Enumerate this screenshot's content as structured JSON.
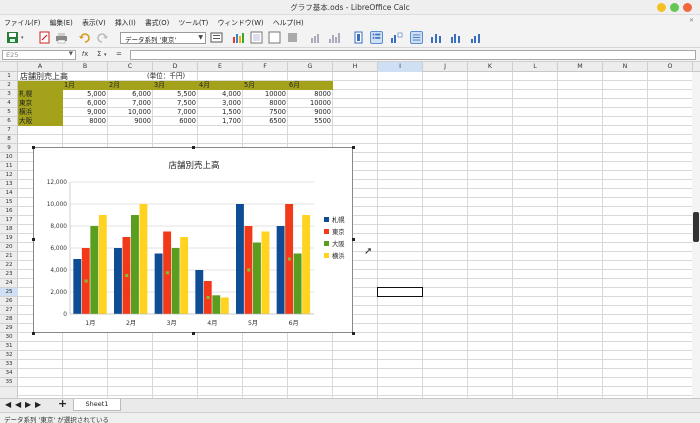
{
  "window": {
    "title": "グラフ基本.ods - LibreOffice Calc"
  },
  "menu": [
    "ファイル(F)",
    "編集(E)",
    "表示(V)",
    "挿入(I)",
    "書式(O)",
    "ツール(T)",
    "ウィンドウ(W)",
    "ヘルプ(H)"
  ],
  "toolbar": {
    "combo_value": "データ系列 '東京'"
  },
  "formula_bar": {
    "name_box": "E25",
    "sum_symbol": "Σ",
    "equals_symbol": "="
  },
  "columns": [
    "A",
    "B",
    "C",
    "D",
    "E",
    "F",
    "G",
    "H",
    "I",
    "J",
    "K",
    "L",
    "M",
    "N",
    "O"
  ],
  "rows": [
    "1",
    "2",
    "3",
    "4",
    "5",
    "6",
    "7",
    "8",
    "9",
    "10",
    "11",
    "12",
    "13",
    "14",
    "15",
    "16",
    "17",
    "18",
    "19",
    "20",
    "21",
    "22",
    "23",
    "24",
    "25",
    "26",
    "27",
    "28",
    "29",
    "30",
    "31",
    "32",
    "33",
    "34",
    "35"
  ],
  "table": {
    "title": "店舗別売上高",
    "unit": "(単位：千円)",
    "months": [
      "1月",
      "2月",
      "3月",
      "4月",
      "5月",
      "6月"
    ],
    "stores": [
      "札幌",
      "東京",
      "横浜",
      "大阪"
    ],
    "values": [
      [
        "5,000",
        "6,000",
        "5,500",
        "4,000",
        "10000",
        "8000"
      ],
      [
        "6,000",
        "7,000",
        "7,500",
        "3,000",
        "8000",
        "10000"
      ],
      [
        "9,000",
        "10,000",
        "7,000",
        "1,500",
        "7500",
        "9000"
      ],
      [
        "8000",
        "9000",
        "6000",
        "1,700",
        "6500",
        "5500"
      ]
    ]
  },
  "chart_data": {
    "type": "bar",
    "title": "店舗別売上高",
    "categories": [
      "1月",
      "2月",
      "3月",
      "4月",
      "5月",
      "6月"
    ],
    "series": [
      {
        "name": "札幌",
        "values": [
          5000,
          6000,
          5500,
          4000,
          10000,
          8000
        ],
        "color": "#0e4c94"
      },
      {
        "name": "東京",
        "values": [
          6000,
          7000,
          7500,
          3000,
          8000,
          10000
        ],
        "color": "#f23a1b"
      },
      {
        "name": "大阪",
        "values": [
          8000,
          9000,
          6000,
          1700,
          6500,
          5500
        ],
        "color": "#5a9e1f"
      },
      {
        "name": "横浜",
        "values": [
          9000,
          10000,
          7000,
          1500,
          7500,
          9000
        ],
        "color": "#ffd320"
      }
    ],
    "ylim": [
      0,
      12000
    ],
    "yticks": [
      "0",
      "2,000",
      "4,000",
      "6,000",
      "8,000",
      "10,000",
      "12,000"
    ],
    "grid": true,
    "legend": "right"
  },
  "tabs": {
    "sheet": "Sheet1",
    "add": "+"
  },
  "status": {
    "text": "データ系列 '東京' が選択されている"
  }
}
